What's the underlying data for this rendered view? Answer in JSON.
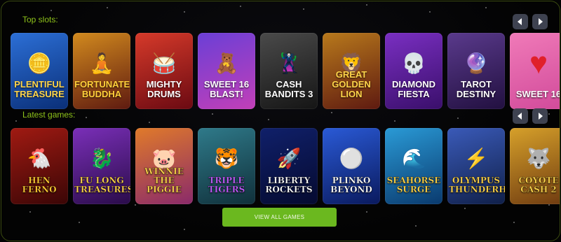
{
  "sections": {
    "top_slots": {
      "title": "Top slots:",
      "games": [
        {
          "title": "PLENTIFUL TREASURE",
          "icon": "gold-coins",
          "colors": [
            "#2c6fd6",
            "#0a2f78"
          ],
          "accent": "#ffd54a"
        },
        {
          "title": "FORTUNATE BUDDHA",
          "icon": "buddha",
          "colors": [
            "#d28a1e",
            "#5e1a10"
          ],
          "accent": "#ffcf3a"
        },
        {
          "title": "MIGHTY DRUMS",
          "icon": "drum",
          "colors": [
            "#d63a2a",
            "#6b0a12"
          ],
          "accent": "#ffffff"
        },
        {
          "title": "SWEET 16 BLAST!",
          "icon": "gummy-bear",
          "colors": [
            "#6b3fd6",
            "#c23fb8"
          ],
          "accent": "#ffffff"
        },
        {
          "title": "CASH BANDITS 3",
          "icon": "bandit",
          "colors": [
            "#4a4a4a",
            "#151515"
          ],
          "accent": "#ffffff"
        },
        {
          "title": "GREAT GOLDEN LION",
          "icon": "lion",
          "colors": [
            "#b8791c",
            "#5e1a10"
          ],
          "accent": "#ffd54a"
        },
        {
          "title": "DIAMOND FIESTA",
          "icon": "skull",
          "colors": [
            "#7a2fc2",
            "#3a0f6b"
          ],
          "accent": "#ffffff"
        },
        {
          "title": "TAROT DESTINY",
          "icon": "fortune-teller",
          "colors": [
            "#5a3a8c",
            "#221040"
          ],
          "accent": "#ffffff"
        },
        {
          "title": "SWEET 16",
          "icon": "heart",
          "colors": [
            "#f07ab8",
            "#d14a9a"
          ],
          "accent": "#ffffff"
        }
      ]
    },
    "latest_games": {
      "title": "Latest games:",
      "games": [
        {
          "title": "HEN FERNO",
          "icon": "chicken",
          "colors": [
            "#a01a12",
            "#3a0606"
          ],
          "accent": "#ffcc33"
        },
        {
          "title": "FU LONG TREASURES",
          "icon": "dragon",
          "colors": [
            "#7a2fb8",
            "#2a0c4a"
          ],
          "accent": "#ffd54a"
        },
        {
          "title": "WINNIE THE PIGGIE",
          "icon": "pig",
          "colors": [
            "#e07a2a",
            "#8a2a6a"
          ],
          "accent": "#ffd54a"
        },
        {
          "title": "TRIPLE TIGERS",
          "icon": "tiger",
          "colors": [
            "#2f7a8a",
            "#10303a"
          ],
          "accent": "#c55cff"
        },
        {
          "title": "LIBERTY ROCKETS",
          "icon": "rocket",
          "colors": [
            "#10206a",
            "#050a30"
          ],
          "accent": "#ffffff"
        },
        {
          "title": "PLINKO BEYOND",
          "icon": "plinko",
          "colors": [
            "#2a5ad6",
            "#0a1a5e"
          ],
          "accent": "#ffffff"
        },
        {
          "title": "SEAHORSE SURGE",
          "icon": "seahorse",
          "colors": [
            "#2a9ad6",
            "#0a3a6e"
          ],
          "accent": "#ffd54a"
        },
        {
          "title": "OLYMPUS THUNDERHOLD",
          "icon": "zeus",
          "colors": [
            "#3a5ab8",
            "#10204a"
          ],
          "accent": "#ffd54a"
        },
        {
          "title": "COYOTE CASH 2",
          "icon": "coyote",
          "colors": [
            "#d6a02a",
            "#6e3a10"
          ],
          "accent": "#ffd54a"
        }
      ]
    }
  },
  "buttons": {
    "view_all": "VIEW ALL GAMES",
    "prev_icon": "chevron-left-icon",
    "next_icon": "chevron-right-icon"
  },
  "colors": {
    "accent": "#8fc41a",
    "button": "#6bb81f",
    "nav": "#3e4250",
    "background": "#030303"
  }
}
